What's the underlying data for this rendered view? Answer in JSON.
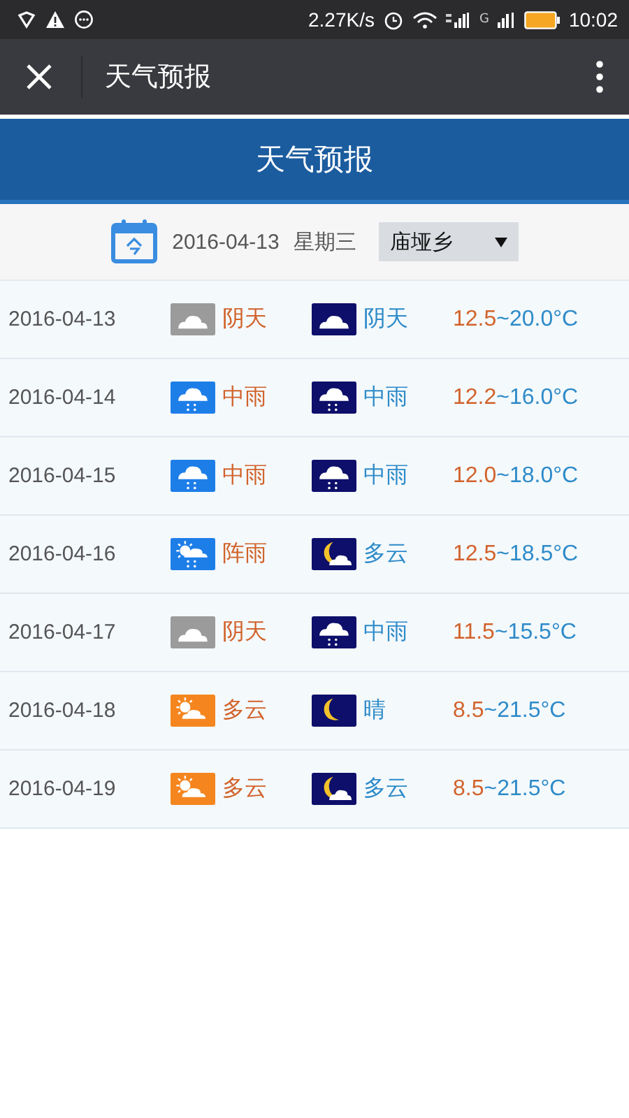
{
  "status_bar": {
    "speed": "2.27K/s",
    "network_label": "G",
    "time": "10:02"
  },
  "app_bar": {
    "title": "天气预报"
  },
  "header": {
    "title": "天气预报"
  },
  "date_bar": {
    "date": "2016-04-13",
    "weekday": "星期三",
    "location": "庙垭乡"
  },
  "forecast": [
    {
      "date": "2016-04-13",
      "day": {
        "kind": "overcast",
        "text": "阴天"
      },
      "night": {
        "kind": "overcast",
        "text": "阴天"
      },
      "low": "12.5",
      "high": "~20.0°C"
    },
    {
      "date": "2016-04-14",
      "day": {
        "kind": "rain",
        "text": "中雨"
      },
      "night": {
        "kind": "rain",
        "text": "中雨"
      },
      "low": "12.2",
      "high": "~16.0°C"
    },
    {
      "date": "2016-04-15",
      "day": {
        "kind": "rain",
        "text": "中雨"
      },
      "night": {
        "kind": "rain",
        "text": "中雨"
      },
      "low": "12.0",
      "high": "~18.0°C"
    },
    {
      "date": "2016-04-16",
      "day": {
        "kind": "shower",
        "text": "阵雨"
      },
      "night": {
        "kind": "cloudy",
        "text": "多云"
      },
      "low": "12.5",
      "high": "~18.5°C"
    },
    {
      "date": "2016-04-17",
      "day": {
        "kind": "overcast",
        "text": "阴天"
      },
      "night": {
        "kind": "rain",
        "text": "中雨"
      },
      "low": "11.5",
      "high": "~15.5°C"
    },
    {
      "date": "2016-04-18",
      "day": {
        "kind": "cloudy",
        "text": "多云"
      },
      "night": {
        "kind": "clear",
        "text": "晴"
      },
      "low": "8.5",
      "high": "~21.5°C"
    },
    {
      "date": "2016-04-19",
      "day": {
        "kind": "cloudy",
        "text": "多云"
      },
      "night": {
        "kind": "cloudy",
        "text": "多云"
      },
      "low": "8.5",
      "high": "~21.5°C"
    }
  ]
}
